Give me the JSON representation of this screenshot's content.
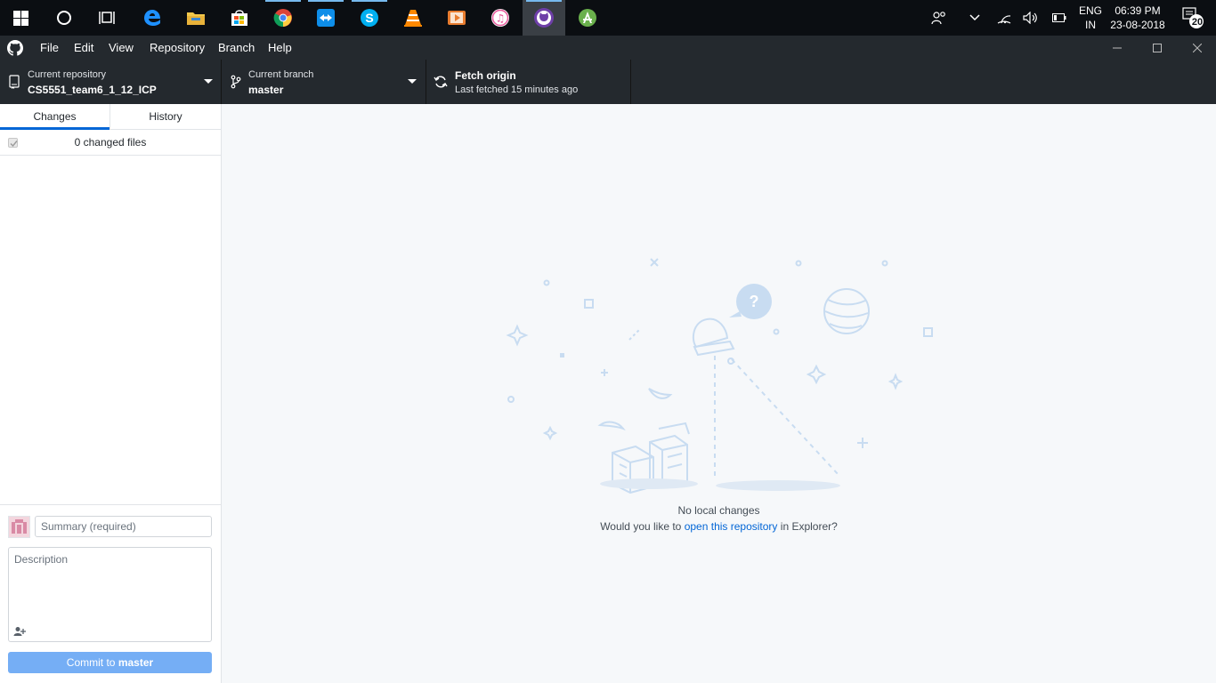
{
  "taskbar": {
    "language_line1": "ENG",
    "language_line2": "IN",
    "time": "06:39 PM",
    "date": "23-08-2018",
    "notification_count": "20"
  },
  "menu": {
    "items": [
      "File",
      "Edit",
      "View",
      "Repository",
      "Branch",
      "Help"
    ]
  },
  "toolbar": {
    "repo_title": "Current repository",
    "repo_name": "CS5551_team6_1_12_ICP",
    "branch_title": "Current branch",
    "branch_name": "master",
    "fetch_title": "Fetch origin",
    "fetch_desc": "Last fetched 15 minutes ago"
  },
  "sidebar": {
    "tabs": [
      "Changes",
      "History"
    ],
    "selected_tab": "Changes",
    "changes_count": "0 changed files",
    "summary_placeholder": "Summary (required)",
    "description_placeholder": "Description",
    "commit_prefix": "Commit to",
    "commit_branch": "master"
  },
  "main": {
    "blank_title": "No local changes",
    "blank_text_before": "Would you like to",
    "blank_link": "open this repository",
    "blank_text_after": "in Explorer?"
  },
  "colors": {
    "accent": "#0366d6",
    "toolbar_bg": "#24292e",
    "commit_button": "#75aef5"
  }
}
